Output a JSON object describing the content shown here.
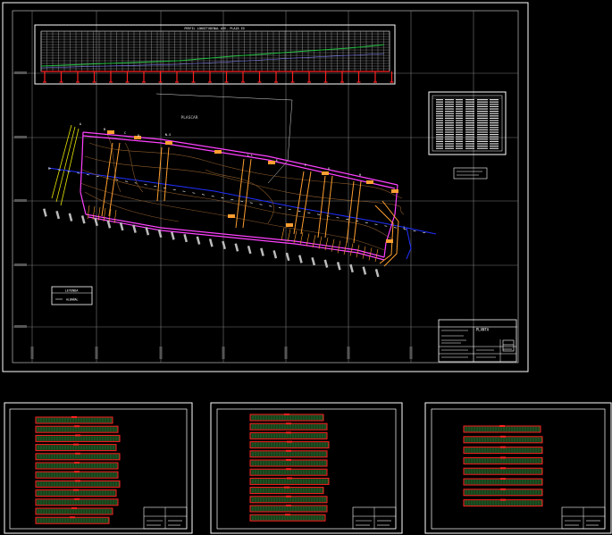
{
  "drawing": {
    "profile_title": "PERFIL LONGITUDINAL AVE. PLAZA ID",
    "area_label": "PLASCAR",
    "legend_title": "LEYENDA",
    "legend_item": "ALBAÑAL",
    "station_labels": [
      "A",
      "B",
      "C",
      "D",
      "N-S",
      "L-L",
      "E",
      "F",
      "G",
      "H",
      "I",
      "J"
    ],
    "titleblock_label": "PLANTA",
    "colors": {
      "background": "#000000",
      "border": "#ffffff",
      "grid": "#8a8a8a",
      "magenta": "#ff40ff",
      "orange": "#ff9f30",
      "brown": "#8b5a2b",
      "blue": "#2030ff",
      "yellow": "#e6e600",
      "red": "#ff2020",
      "green": "#20c040"
    }
  }
}
